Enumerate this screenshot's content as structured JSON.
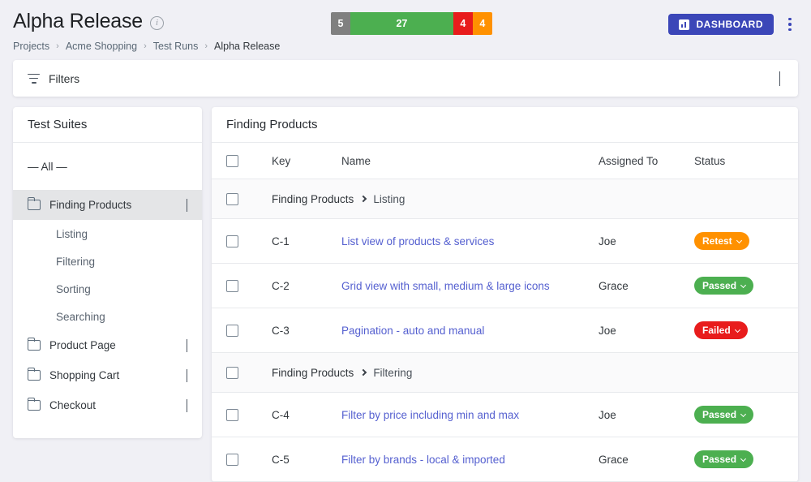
{
  "header": {
    "title": "Alpha Release",
    "info_icon": "info-circle-icon",
    "breadcrumb": [
      "Projects",
      "Acme Shopping",
      "Test Runs",
      "Alpha Release"
    ],
    "dashboard_button": "DASHBOARD",
    "dashboard_icon": "bar-chart-icon",
    "kebab_icon": "more-vertical-icon"
  },
  "stats": {
    "segments": [
      {
        "label": "5",
        "color": "#808080",
        "status": "untested"
      },
      {
        "label": "27",
        "color": "#4caf50",
        "status": "passed"
      },
      {
        "label": "4",
        "color": "#e81c1c",
        "status": "failed"
      },
      {
        "label": "4",
        "color": "#ff9100",
        "status": "retest"
      }
    ]
  },
  "filters": {
    "label": "Filters",
    "icon": "filter-icon",
    "chevron": "chevron-down-icon"
  },
  "sidebar": {
    "title": "Test Suites",
    "all_label": "— All —",
    "suites": [
      {
        "label": "Finding Products",
        "expanded": true,
        "active": true,
        "children": [
          "Listing",
          "Filtering",
          "Sorting",
          "Searching"
        ]
      },
      {
        "label": "Product Page",
        "expanded": false,
        "active": false,
        "children": []
      },
      {
        "label": "Shopping Cart",
        "expanded": false,
        "active": false,
        "children": []
      },
      {
        "label": "Checkout",
        "expanded": false,
        "active": false,
        "children": []
      }
    ]
  },
  "table": {
    "title": "Finding Products",
    "columns": {
      "key": "Key",
      "name": "Name",
      "assigned": "Assigned To",
      "status": "Status"
    },
    "rows": [
      {
        "type": "group",
        "parent": "Finding Products",
        "child": "Listing"
      },
      {
        "type": "case",
        "key": "C-1",
        "name": "List view of products & services",
        "assigned": "Joe",
        "status": "Retest",
        "status_color": "#ff9100"
      },
      {
        "type": "case",
        "key": "C-2",
        "name": "Grid view with small, medium & large icons",
        "assigned": "Grace",
        "status": "Passed",
        "status_color": "#4caf50"
      },
      {
        "type": "case",
        "key": "C-3",
        "name": "Pagination - auto and manual",
        "assigned": "Joe",
        "status": "Failed",
        "status_color": "#e81c1c"
      },
      {
        "type": "group",
        "parent": "Finding Products",
        "child": "Filtering"
      },
      {
        "type": "case",
        "key": "C-4",
        "name": "Filter by price including min and max",
        "assigned": "Joe",
        "status": "Passed",
        "status_color": "#4caf50"
      },
      {
        "type": "case",
        "key": "C-5",
        "name": "Filter by brands - local & imported",
        "assigned": "Grace",
        "status": "Passed",
        "status_color": "#4caf50"
      }
    ]
  },
  "colors": {
    "accent": "#3b46b8",
    "link": "#5560d0",
    "page_bg": "#f0f0f5"
  }
}
